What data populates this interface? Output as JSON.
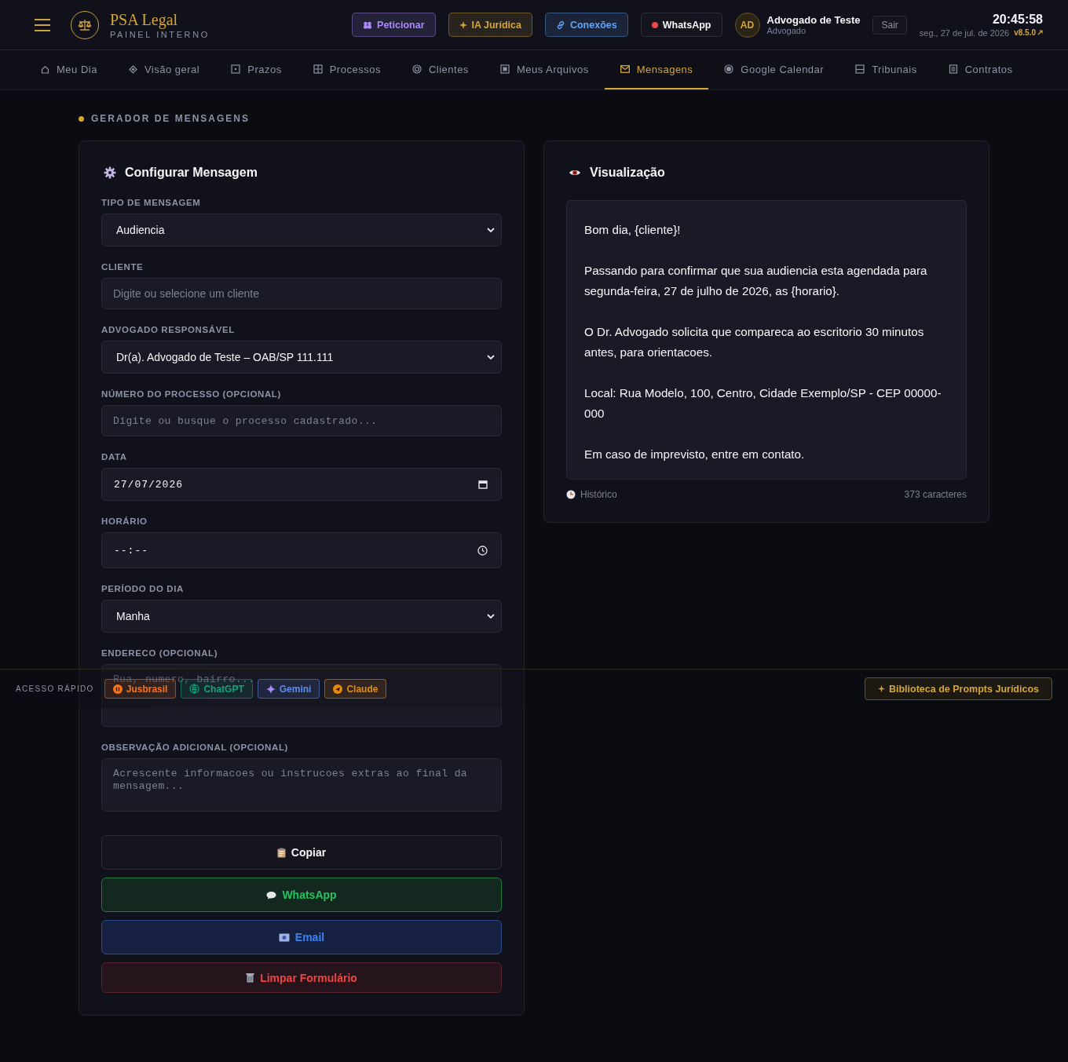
{
  "header": {
    "title": "PSA Legal",
    "subtitle": "PAINEL INTERNO",
    "actions": [
      {
        "label": "Peticionar",
        "color": "#a78bfa"
      },
      {
        "label": "IA Jurídica",
        "color": "#d4a537"
      },
      {
        "label": "Conexões",
        "color": "#60a5fa"
      },
      {
        "label": "WhatsApp",
        "color": "#ef4444"
      }
    ],
    "user": {
      "initials": "AD",
      "name": "Advogado de Teste",
      "role": "Advogado"
    },
    "logout": "Sair",
    "clock": {
      "time": "20:45:58",
      "date": "seg., 27 de jul. de 2026",
      "version": "v8.5.0"
    }
  },
  "nav": [
    {
      "label": "Meu Dia",
      "selected": false
    },
    {
      "label": "Visão geral",
      "selected": false
    },
    {
      "label": "Prazos",
      "selected": false
    },
    {
      "label": "Processos",
      "selected": false
    },
    {
      "label": "Clientes",
      "selected": false
    },
    {
      "label": "Meus Arquivos",
      "selected": false
    },
    {
      "label": "Mensagens",
      "selected": true
    },
    {
      "label": "Google Calendar",
      "selected": false
    },
    {
      "label": "Tribunais",
      "selected": false
    },
    {
      "label": "Contratos",
      "selected": false
    }
  ],
  "section_title": "GERADOR DE MENSAGENS",
  "form": {
    "title": "Configurar Mensagem",
    "fields": [
      {
        "kind": "select",
        "label": "TIPO DE MENSAGEM",
        "value": "Audiencia"
      },
      {
        "kind": "input",
        "label": "CLIENTE",
        "placeholder": "Digite ou selecione um cliente"
      },
      {
        "kind": "select",
        "label": "ADVOGADO RESPONSÁVEL",
        "value": "Dr(a). Advogado de Teste – OAB/SP 111.111"
      },
      {
        "kind": "mono-input",
        "label": "NÚMERO DO PROCESSO (OPCIONAL)",
        "placeholder": "Digite ou busque o processo cadastrado..."
      },
      {
        "kind": "date",
        "label": "DATA",
        "value": "27/07/2026"
      },
      {
        "kind": "time",
        "label": "HORÁRIO",
        "value": "--:--"
      },
      {
        "kind": "select",
        "label": "PERÍODO DO DIA",
        "value": "Manha"
      },
      {
        "kind": "textarea",
        "label": "ENDERECO (OPCIONAL)",
        "placeholder": "Rua, numero, bairro..."
      },
      {
        "kind": "textarea-short",
        "label": "OBSERVAÇÃO ADICIONAL (OPCIONAL)",
        "placeholder": "Acrescente informacoes ou instrucoes extras ao final da mensagem..."
      }
    ],
    "buttons": [
      {
        "kind": "copy",
        "label": "Copiar"
      },
      {
        "kind": "whatsapp",
        "label": "WhatsApp"
      },
      {
        "kind": "email",
        "label": "Email"
      },
      {
        "kind": "clear",
        "label": "Limpar Formulário"
      }
    ]
  },
  "preview": {
    "title": "Visualização",
    "paragraphs": [
      "Bom dia, {cliente}!",
      "Passando para confirmar que sua audiencia esta agendada para segunda-feira, 27 de julho de 2026, as {horario}.",
      "O Dr. Advogado solicita que compareca ao escritorio 30 minutos antes, para orientacoes.",
      "Local: Rua Modelo, 100, Centro, Cidade Exemplo/SP - CEP 00000-000",
      "Em caso de imprevisto, entre em contato."
    ],
    "history": "Histórico",
    "count": "373 caracteres"
  },
  "quick_access": {
    "label": "ACESSO RÁPIDO",
    "links": [
      {
        "label": "Jusbrasil",
        "color": "#f97316"
      },
      {
        "label": "ChatGPT",
        "color": "#10a37f"
      },
      {
        "label": "Gemini",
        "color": "#5b8def"
      },
      {
        "label": "Claude",
        "color": "#e58a0b"
      }
    ],
    "library": "Biblioteca de Prompts Jurídicos"
  }
}
